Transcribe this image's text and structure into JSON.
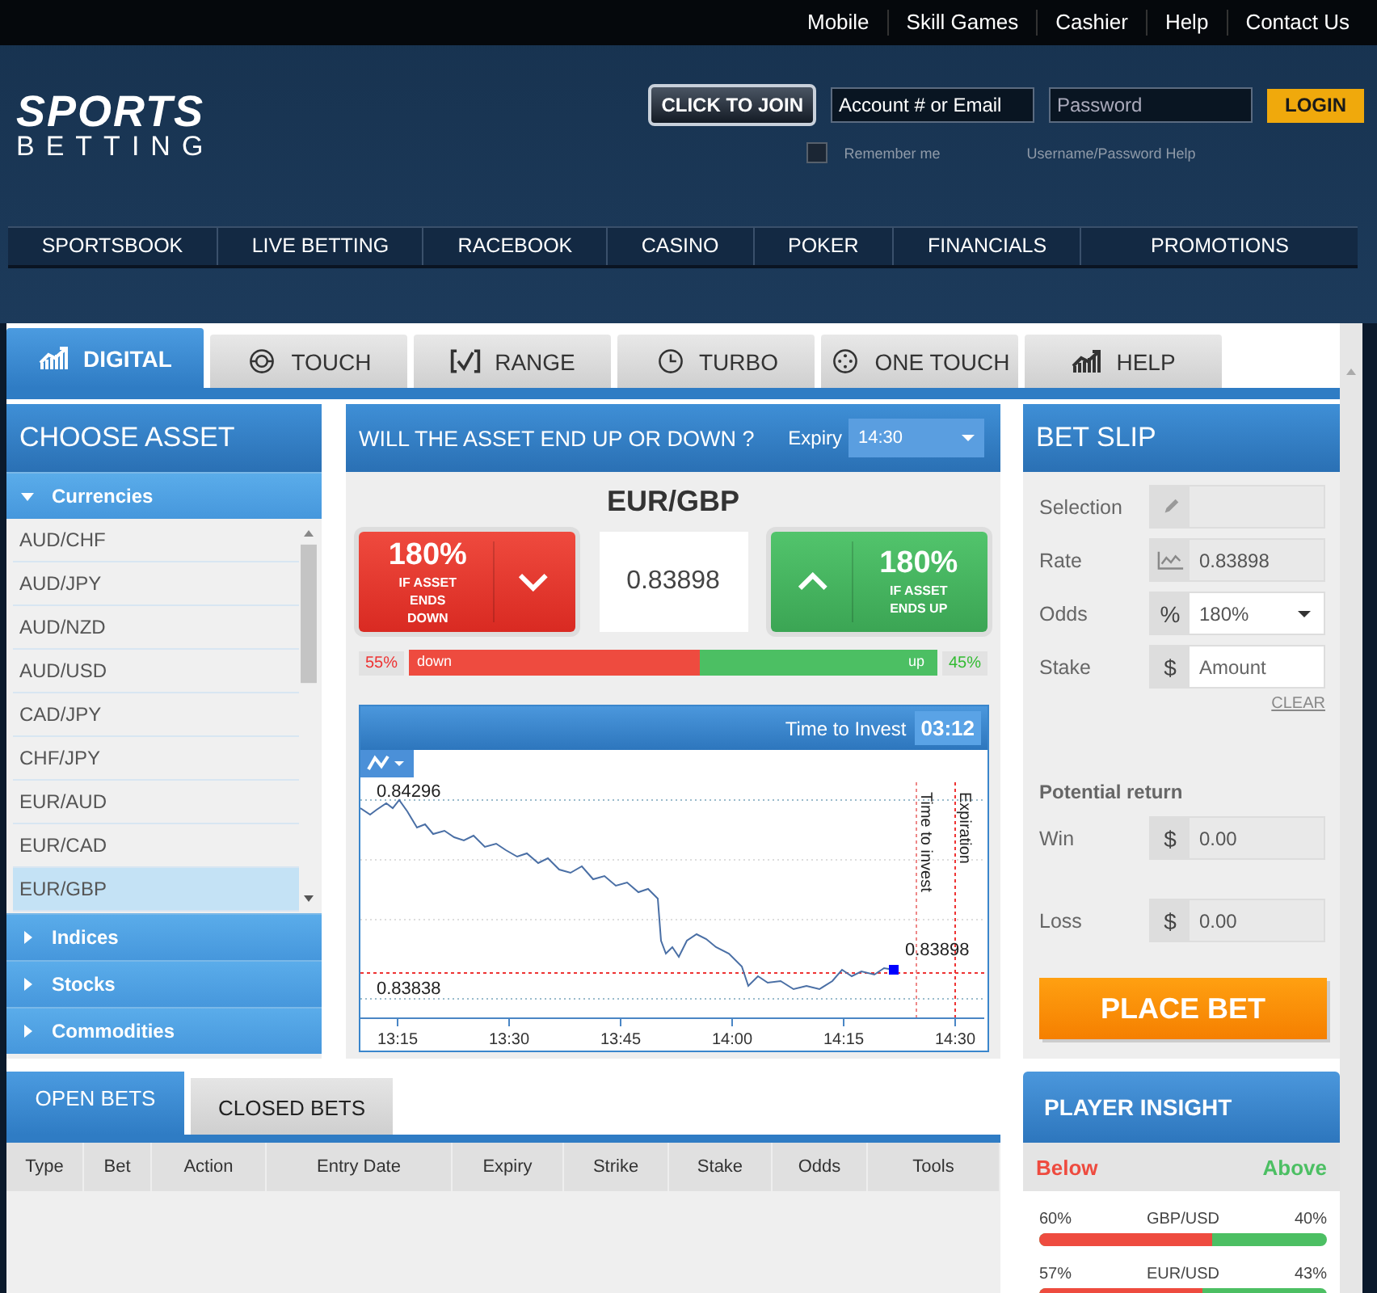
{
  "top_links": [
    "Mobile",
    "Skill Games",
    "Cashier",
    "Help",
    "Contact Us"
  ],
  "logo": {
    "top": "SPORTS",
    "bottom": "BETTING"
  },
  "login": {
    "join": "CLICK TO JOIN",
    "account_placeholder": "Account # or Email",
    "password_placeholder": "Password",
    "button": "LOGIN",
    "remember": "Remember me",
    "remember_checked": false,
    "help": "Username/Password Help"
  },
  "nav": [
    "SPORTSBOOK",
    "LIVE BETTING",
    "RACEBOOK",
    "CASINO",
    "POKER",
    "FINANCIALS",
    "PROMOTIONS"
  ],
  "tabs": [
    {
      "label": "DIGITAL",
      "selected": true
    },
    {
      "label": "TOUCH",
      "selected": false
    },
    {
      "label": "RANGE",
      "selected": false
    },
    {
      "label": "TURBO",
      "selected": false
    },
    {
      "label": "ONE TOUCH",
      "selected": false
    },
    {
      "label": "HELP",
      "selected": false
    }
  ],
  "asset_panel": {
    "title": "CHOOSE ASSET",
    "categories": [
      {
        "label": "Currencies",
        "expanded": true,
        "items": [
          {
            "label": "AUD/CHF",
            "selected": false
          },
          {
            "label": "AUD/JPY",
            "selected": false
          },
          {
            "label": "AUD/NZD",
            "selected": false
          },
          {
            "label": "AUD/USD",
            "selected": false
          },
          {
            "label": "CAD/JPY",
            "selected": false
          },
          {
            "label": "CHF/JPY",
            "selected": false
          },
          {
            "label": "EUR/AUD",
            "selected": false
          },
          {
            "label": "EUR/CAD",
            "selected": false
          },
          {
            "label": "EUR/GBP",
            "selected": true
          }
        ]
      },
      {
        "label": "Indices",
        "expanded": false
      },
      {
        "label": "Stocks",
        "expanded": false
      },
      {
        "label": "Commodities",
        "expanded": false
      }
    ]
  },
  "trade": {
    "question": "WILL THE ASSET END UP OR DOWN ?",
    "expiry_label": "Expiry",
    "expiry_value": "14:30",
    "asset": "EUR/GBP",
    "price": "0.83898",
    "down": {
      "payout": "180%",
      "caption": "IF ASSET ENDS DOWN"
    },
    "up": {
      "payout": "180%",
      "caption": "IF ASSET ENDS UP"
    },
    "sentiment": {
      "down_share": "55%",
      "down_label": "down",
      "up_label": "up",
      "up_share": "45%",
      "level": 0.55
    },
    "chart": {
      "timer_label": "Time to Invest",
      "timer": "03:12",
      "high": "0.84296",
      "low": "0.83838",
      "current": "0.83898",
      "markers": [
        "Time to invest",
        "Expiration"
      ],
      "x_labels": [
        "13:15",
        "13:30",
        "13:45",
        "14:00",
        "14:15",
        "14:30"
      ]
    }
  },
  "bet_slip": {
    "title": "BET SLIP",
    "fields": [
      {
        "label": "Selection",
        "kind": "selection",
        "editable": false
      },
      {
        "label": "Rate",
        "kind": "rate",
        "value": "0.83898",
        "editable": false
      },
      {
        "label": "Odds",
        "kind": "select",
        "addon": "%",
        "value": "180%",
        "editable": true
      },
      {
        "label": "Stake",
        "kind": "input",
        "addon": "$",
        "placeholder": "Amount",
        "editable": true
      }
    ],
    "clear": "CLEAR",
    "return_title": "Potential return",
    "returns": [
      {
        "label": "Win",
        "addon": "$",
        "value": "0.00",
        "editable": false
      },
      {
        "label": "Loss",
        "addon": "$",
        "value": "0.00",
        "editable": false
      }
    ],
    "place_bet": "PLACE BET"
  },
  "bets": {
    "tabs": [
      {
        "label": "OPEN BETS",
        "selected": true
      },
      {
        "label": "CLOSED BETS",
        "selected": false
      }
    ],
    "columns": [
      "Type",
      "Bet",
      "Action",
      "Entry Date",
      "Expiry",
      "Strike",
      "Stake",
      "Odds",
      "Tools"
    ]
  },
  "insight": {
    "title": "PLAYER INSIGHT",
    "below": "Below",
    "above": "Above",
    "rows": [
      {
        "below": "60%",
        "pair": "GBP/USD",
        "above": "40%",
        "level": 0.6
      },
      {
        "below": "57%",
        "pair": "EUR/USD",
        "above": "43%",
        "level": 0.57
      }
    ]
  }
}
